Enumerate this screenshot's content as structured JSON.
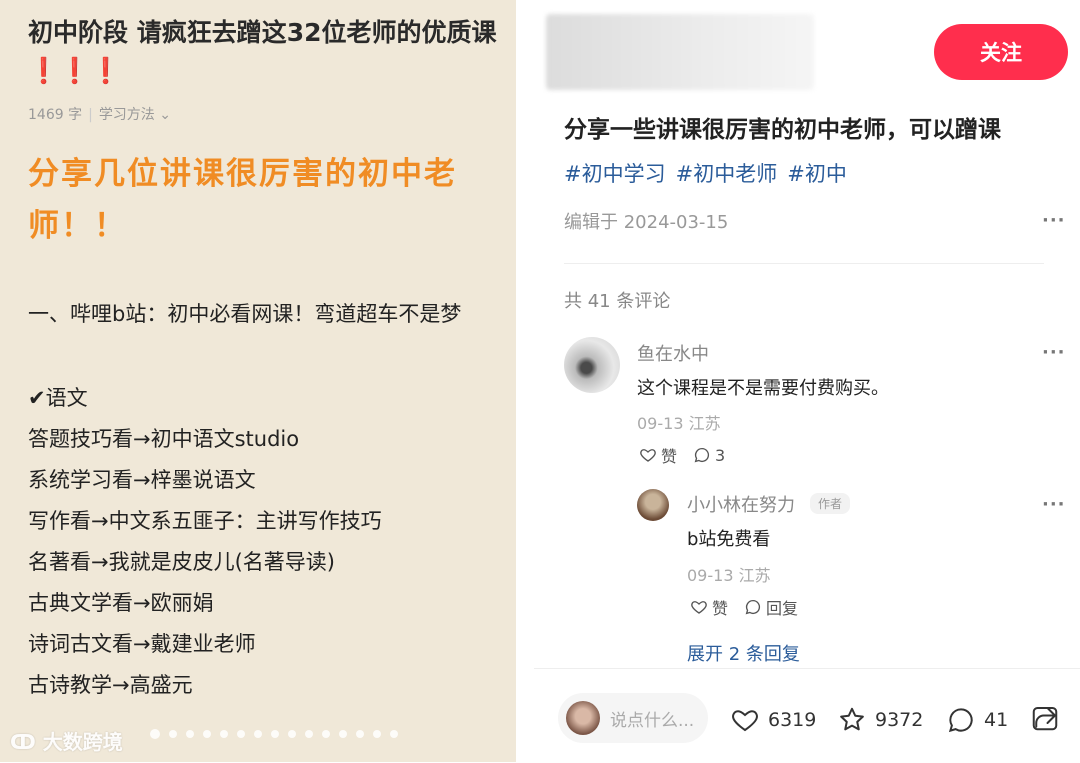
{
  "note": {
    "title": "初中阶段 请疯狂去蹭这32位老师的优质课❗❗❗",
    "word_count": "1469 字",
    "category": "学习方法",
    "heading": "分享几位讲课很厉害的初中老师！！",
    "intro": "一、哔哩b站：初中必看网课！弯道超车不是梦",
    "section": "✔语文",
    "lines": [
      "答题技巧看→初中语文studio",
      "系统学习看→梓墨说语文",
      "写作看→中文系五匪子：主讲写作技巧",
      "名著看→我就是皮皮儿(名著导读)",
      "古典文学看→欧丽娟",
      "诗词古文看→戴建业老师",
      "古诗教学→高盛元"
    ],
    "watermark": "大数跨境"
  },
  "post": {
    "follow_label": "关注",
    "title": "分享一些讲课很厉害的初中老师，可以蹭课",
    "tags": [
      "#初中学习",
      "#初中老师",
      "#初中"
    ],
    "edit_date": "编辑于 2024-03-15",
    "more": "···"
  },
  "comments": {
    "count_label": "共 41 条评论",
    "items": [
      {
        "name": "鱼在水中",
        "text": "这个课程是不是需要付费购买。",
        "meta": "09-13 江苏",
        "like_label": "赞",
        "reply_count": "3"
      }
    ],
    "reply": {
      "name": "小小林在努力",
      "badge": "作者",
      "text": "b站免费看",
      "meta": "09-13 江苏",
      "like_label": "赞",
      "reply_label": "回复"
    },
    "expand_label": "展开 2 条回复"
  },
  "bottom": {
    "placeholder": "说点什么...",
    "likes": "6319",
    "stars": "9372",
    "comments": "41"
  },
  "colors": {
    "accent": "#ff2e4d",
    "tag": "#2b5c9a",
    "heading": "#f08c24",
    "note_bg": "#f0e8d8"
  }
}
